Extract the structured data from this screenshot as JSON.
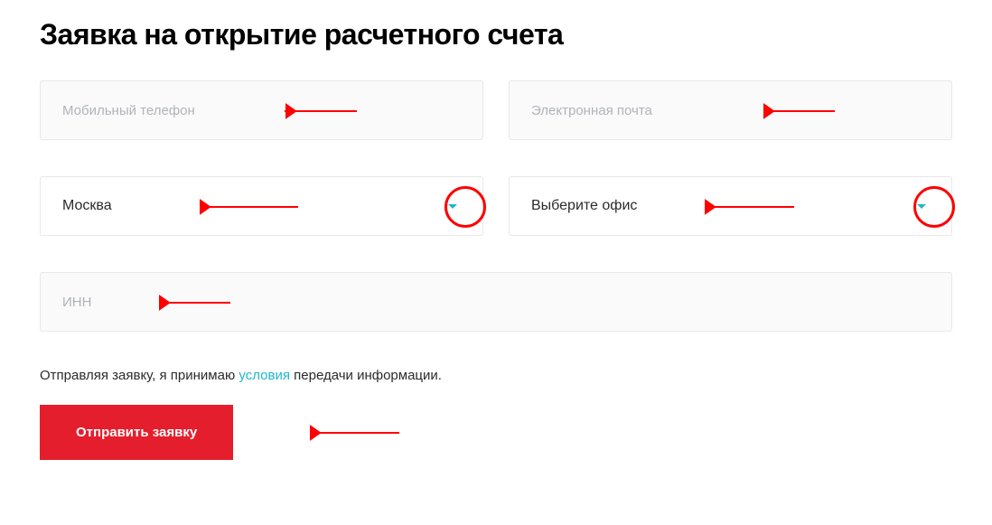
{
  "title": "Заявка на открытие расчетного счета",
  "fields": {
    "phone": {
      "placeholder": "Мобильный телефон",
      "value": ""
    },
    "email": {
      "placeholder": "Электронная почта",
      "value": ""
    },
    "city": {
      "selected": "Москва"
    },
    "office": {
      "selected": "Выберите офис"
    },
    "inn": {
      "placeholder": "ИНН",
      "value": ""
    }
  },
  "consent": {
    "prefix": "Отправляя заявку, я принимаю ",
    "link": "условия",
    "suffix": " передачи информации."
  },
  "submit": "Отправить заявку",
  "colors": {
    "accent": "#1fb7cc",
    "primary": "#e41e2d",
    "annotation": "#ff0000"
  }
}
